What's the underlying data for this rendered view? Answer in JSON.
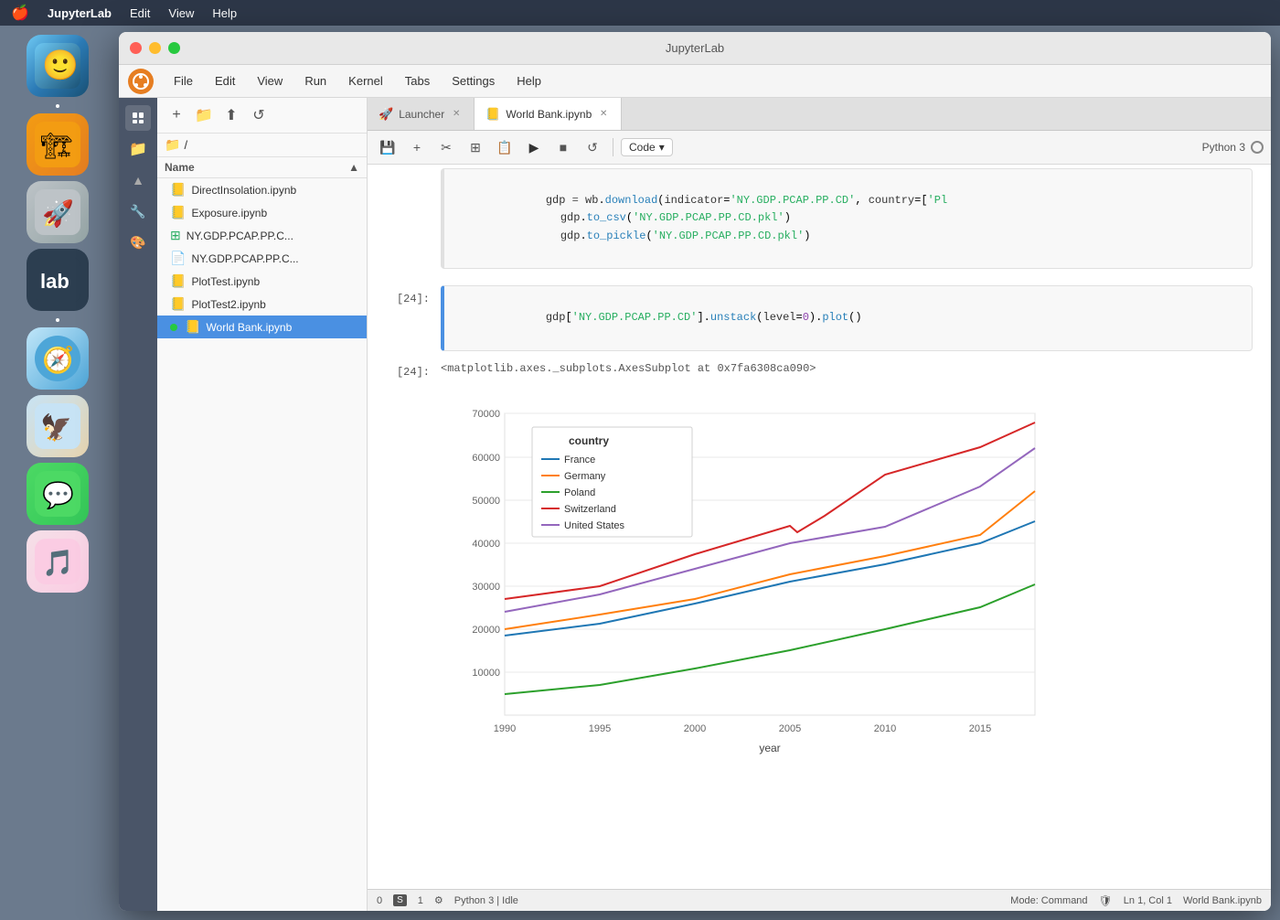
{
  "macos": {
    "menubar": {
      "apple": "🍎",
      "app_name": "JupyterLab",
      "menu_items": [
        "Edit",
        "View",
        "Help"
      ]
    }
  },
  "window": {
    "title": "JupyterLab",
    "app_menu": [
      "File",
      "Edit",
      "View",
      "Run",
      "Kernel",
      "Tabs",
      "Settings",
      "Help"
    ]
  },
  "tabs": [
    {
      "id": "launcher",
      "label": "Launcher",
      "icon": "🚀",
      "active": false
    },
    {
      "id": "worldbank",
      "label": "World Bank.ipynb",
      "icon": "📒",
      "active": true
    }
  ],
  "toolbar": {
    "save_label": "💾",
    "add_label": "+",
    "cut_label": "✂️",
    "copy_label": "⊞",
    "paste_label": "📋",
    "run_label": "▶",
    "stop_label": "■",
    "restart_label": "↺",
    "cell_type": "Code",
    "kernel": "Python 3"
  },
  "file_browser": {
    "path": "/",
    "files": [
      {
        "name": "DirectInsolation.ipynb",
        "type": "notebook",
        "icon": "orange"
      },
      {
        "name": "Exposure.ipynb",
        "type": "notebook",
        "icon": "orange"
      },
      {
        "name": "NY.GDP.PCAP.PP.C...",
        "type": "csv",
        "icon": "green"
      },
      {
        "name": "NY.GDP.PCAP.PP.C...",
        "type": "file",
        "icon": "plain"
      },
      {
        "name": "PlotTest.ipynb",
        "type": "notebook",
        "icon": "orange"
      },
      {
        "name": "PlotTest2.ipynb",
        "type": "notebook",
        "icon": "orange"
      },
      {
        "name": "World Bank.ipynb",
        "type": "notebook",
        "icon": "orange",
        "active": true,
        "running": true
      }
    ]
  },
  "notebook": {
    "cells": [
      {
        "id": "code1",
        "type": "code",
        "prompt": "",
        "lines": [
          "gdp = wb.download(indicator='NY.GDP.PCAP.PP.CD', country=['Pl",
          "    gdp.to_csv('NY.GDP.PCAP.PP.CD.pkl')",
          "    gdp.to_pickle('NY.GDP.PCAP.PP.CD.pkl')"
        ]
      },
      {
        "id": "code24",
        "type": "code",
        "prompt": "[24]:",
        "code": "gdp['NY.GDP.PCAP.PP.CD'].unstack(level=0).plot()"
      },
      {
        "id": "out24",
        "type": "output",
        "prompt": "[24]:",
        "text": "<matplotlib.axes._subplots.AxesSubplot at 0x7fa6308ca090>"
      }
    ]
  },
  "chart": {
    "title": "",
    "x_label": "year",
    "y_label": "",
    "x_ticks": [
      "1990",
      "1995",
      "2000",
      "2005",
      "2010",
      "2015"
    ],
    "y_ticks": [
      "10000",
      "20000",
      "30000",
      "40000",
      "50000",
      "60000",
      "70000"
    ],
    "legend_title": "country",
    "series": [
      {
        "name": "France",
        "color": "#1f77b4",
        "points": [
          [
            0,
            18500
          ],
          [
            5,
            21000
          ],
          [
            10,
            26000
          ],
          [
            15,
            31000
          ],
          [
            20,
            35000
          ],
          [
            25,
            39000
          ],
          [
            27,
            45000
          ]
        ]
      },
      {
        "name": "Germany",
        "color": "#ff7f0e",
        "points": [
          [
            0,
            20000
          ],
          [
            5,
            23000
          ],
          [
            10,
            27000
          ],
          [
            15,
            33000
          ],
          [
            20,
            37000
          ],
          [
            25,
            42000
          ],
          [
            27,
            52000
          ]
        ]
      },
      {
        "name": "Poland",
        "color": "#2ca02c",
        "points": [
          [
            0,
            5000
          ],
          [
            5,
            7000
          ],
          [
            10,
            11000
          ],
          [
            15,
            15000
          ],
          [
            20,
            20000
          ],
          [
            25,
            25000
          ],
          [
            27,
            30500
          ]
        ]
      },
      {
        "name": "Switzerland",
        "color": "#d62728",
        "points": [
          [
            0,
            27000
          ],
          [
            5,
            30000
          ],
          [
            10,
            38000
          ],
          [
            15,
            50000
          ],
          [
            20,
            58000
          ],
          [
            25,
            63000
          ],
          [
            27,
            68000
          ]
        ]
      },
      {
        "name": "United States",
        "color": "#9467bd",
        "points": [
          [
            0,
            24000
          ],
          [
            5,
            28000
          ],
          [
            10,
            34000
          ],
          [
            15,
            42000
          ],
          [
            20,
            46000
          ],
          [
            25,
            56000
          ],
          [
            27,
            62000
          ]
        ]
      }
    ]
  },
  "statusbar": {
    "items_left": [
      "0",
      "S 1",
      "⚙"
    ],
    "kernel_status": "Python 3 | Idle",
    "mode": "Mode: Command",
    "position": "Ln 1, Col 1",
    "filename": "World Bank.ipynb"
  }
}
